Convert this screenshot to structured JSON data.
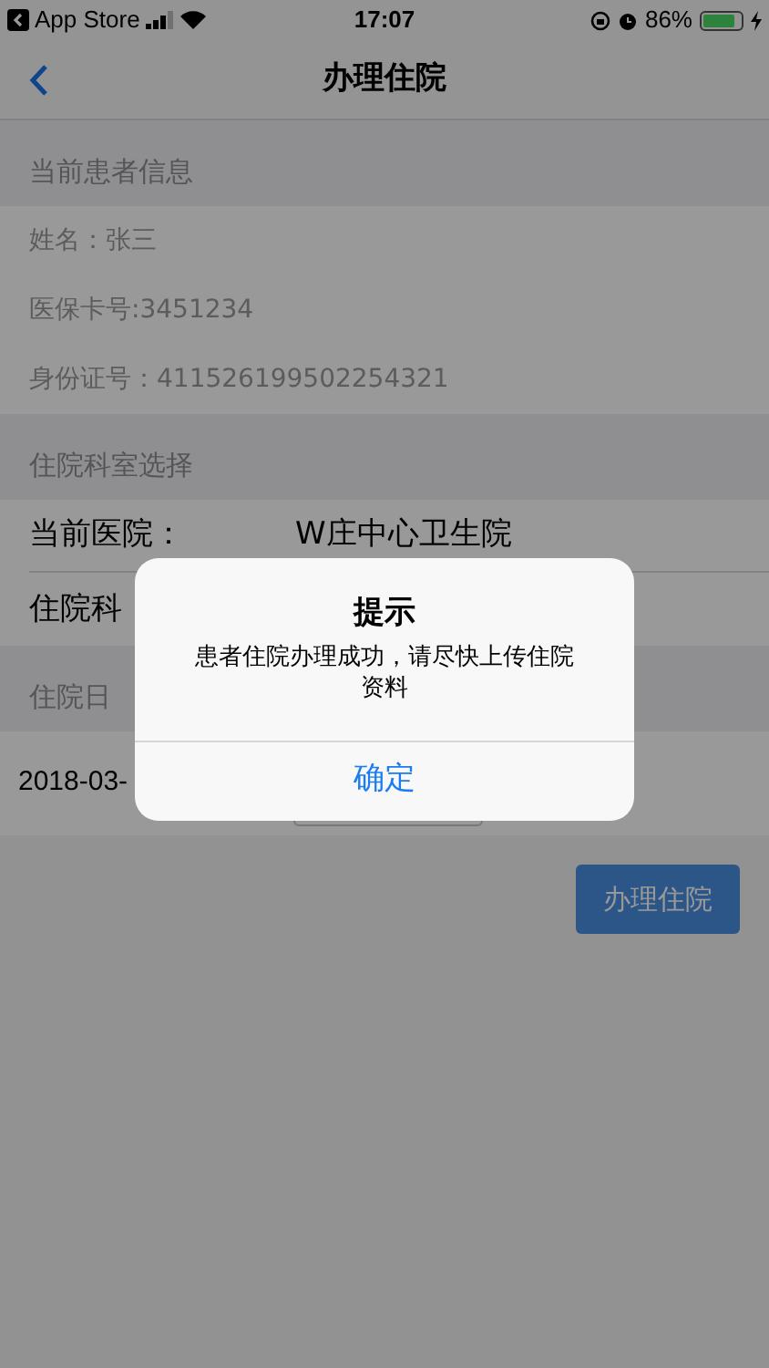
{
  "status_bar": {
    "back_app": "App Store",
    "time": "17:07",
    "battery": "86%"
  },
  "nav": {
    "title": "办理住院"
  },
  "sections": [
    {
      "header": "当前患者信息",
      "kind": "info",
      "rows": [
        {
          "text": "姓名：张三"
        },
        {
          "text": "医保卡号:3451234"
        },
        {
          "text": "身份证号：411526199502254321"
        }
      ]
    },
    {
      "header": "住院科室选择",
      "kind": "fields",
      "rows": [
        {
          "label": "当前医院：",
          "value": "W庄中心卫生院"
        },
        {
          "label": "住院科"
        }
      ]
    },
    {
      "header": "住院日",
      "kind": "date",
      "rows": [
        {
          "text": "2018-03-"
        }
      ]
    }
  ],
  "submit_button": "办理住院",
  "dialog": {
    "title": "提示",
    "message": "患者住院办理成功，请尽快上传住院资料",
    "button": "确定"
  }
}
